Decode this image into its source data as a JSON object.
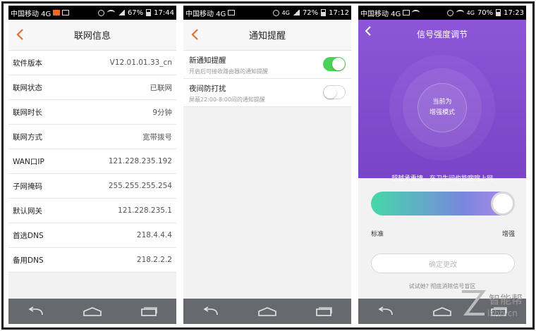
{
  "screens": [
    {
      "status": {
        "carrier": "中国移动 4G",
        "battery": "67%",
        "time": "17:44"
      },
      "title": "联网信息",
      "rows": [
        {
          "label": "软件版本",
          "value": "V12.01.01.33_cn"
        },
        {
          "label": "联网状态",
          "value": "已联网"
        },
        {
          "label": "联网时长",
          "value": "9分钟"
        },
        {
          "label": "联网方式",
          "value": "宽带拨号"
        },
        {
          "label": "WAN口IP",
          "value": "121.228.235.192"
        },
        {
          "label": "子网掩码",
          "value": "255.255.255.254"
        },
        {
          "label": "默认网关",
          "value": "121.228.235.1"
        },
        {
          "label": "首选DNS",
          "value": "218.4.4.4"
        },
        {
          "label": "备用DNS",
          "value": "218.2.2.2"
        }
      ]
    },
    {
      "status": {
        "carrier": "中国移动 4G",
        "network": "4G",
        "battery": "72%",
        "time": "17:12"
      },
      "title": "通知提醒",
      "items": [
        {
          "title": "新通知提醒",
          "sub": "开启后可接收路由器的通知提醒",
          "enabled": true
        },
        {
          "title": "夜间防打扰",
          "sub": "屏蔽22:00-8:00间的通知提醒",
          "enabled": false
        }
      ]
    },
    {
      "status": {
        "carrier": "中国移动 4G",
        "network": "4G",
        "battery": "70%",
        "time": "17:23"
      },
      "title": "信号强度调节",
      "circle_line1": "当前为",
      "circle_line2": "增强模式",
      "description": "超越承重墙，在卫生间也能嗖嗖上网",
      "slider_min_label": "标准",
      "slider_max_label": "增强",
      "slider_value": 1,
      "confirm_label": "确定更改",
      "hint": "试试她? 彻底消除信号盲区"
    }
  ],
  "watermark": {
    "text": "智能帮",
    "url": "lzhb.cn"
  },
  "colors": {
    "accent": "#ee6b2c",
    "toggle_on": "#4cd25a",
    "purple": "#8d55d8",
    "navbar": "#666a6e"
  },
  "icons": [
    "back-arrow-icon",
    "nav-back-icon",
    "nav-home-icon",
    "nav-recents-icon"
  ]
}
